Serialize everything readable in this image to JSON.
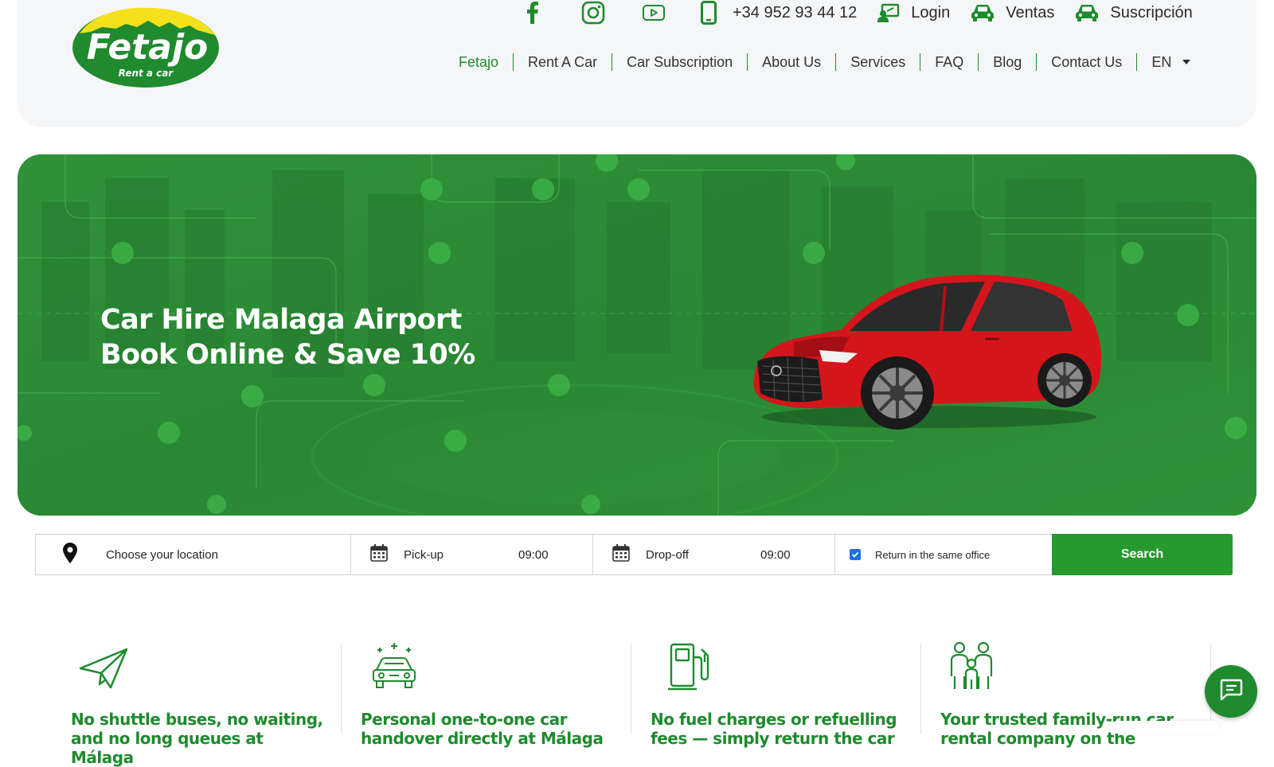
{
  "header": {
    "logo": {
      "brand": "Fetajo",
      "tagline": "Rent a car"
    },
    "social": [
      {
        "icon": "facebook-icon"
      },
      {
        "icon": "instagram-icon"
      },
      {
        "icon": "youtube-icon"
      }
    ],
    "phone": "+34 952 93 44 12",
    "login_label": "Login",
    "ventas_label": "Ventas",
    "suscripcion_label": "Suscripción",
    "nav": [
      {
        "label": "Fetajo",
        "active": true
      },
      {
        "label": "Rent A Car"
      },
      {
        "label": "Car Subscription"
      },
      {
        "label": "About Us"
      },
      {
        "label": "Services"
      },
      {
        "label": "FAQ"
      },
      {
        "label": "Blog"
      },
      {
        "label": "Contact Us"
      }
    ],
    "language": "EN"
  },
  "hero": {
    "title_line1": "Car Hire Malaga Airport",
    "title_line2": "Book Online & Save 10%"
  },
  "search": {
    "location_placeholder": "Choose your location",
    "pickup_label": "Pick-up",
    "pickup_time": "09:00",
    "dropoff_label": "Drop-off",
    "dropoff_time": "09:00",
    "return_same_office": "Return in the same office",
    "return_checked": true,
    "button_label": "Search"
  },
  "features": [
    {
      "icon": "paper-plane-icon",
      "title": "No shuttle buses, no waiting, and no long queues at Málaga"
    },
    {
      "icon": "car-handover-icon",
      "title": "Personal one-to-one car handover directly at Málaga"
    },
    {
      "icon": "fuel-pump-icon",
      "title": "No fuel charges or refuelling fees — simply return the car"
    },
    {
      "icon": "family-icon",
      "title": "Your trusted family-run car rental company on the"
    }
  ],
  "colors": {
    "brand_green": "#1f8a2e",
    "hero_green": "#2a8b35",
    "logo_yellow": "#f2e11b"
  }
}
